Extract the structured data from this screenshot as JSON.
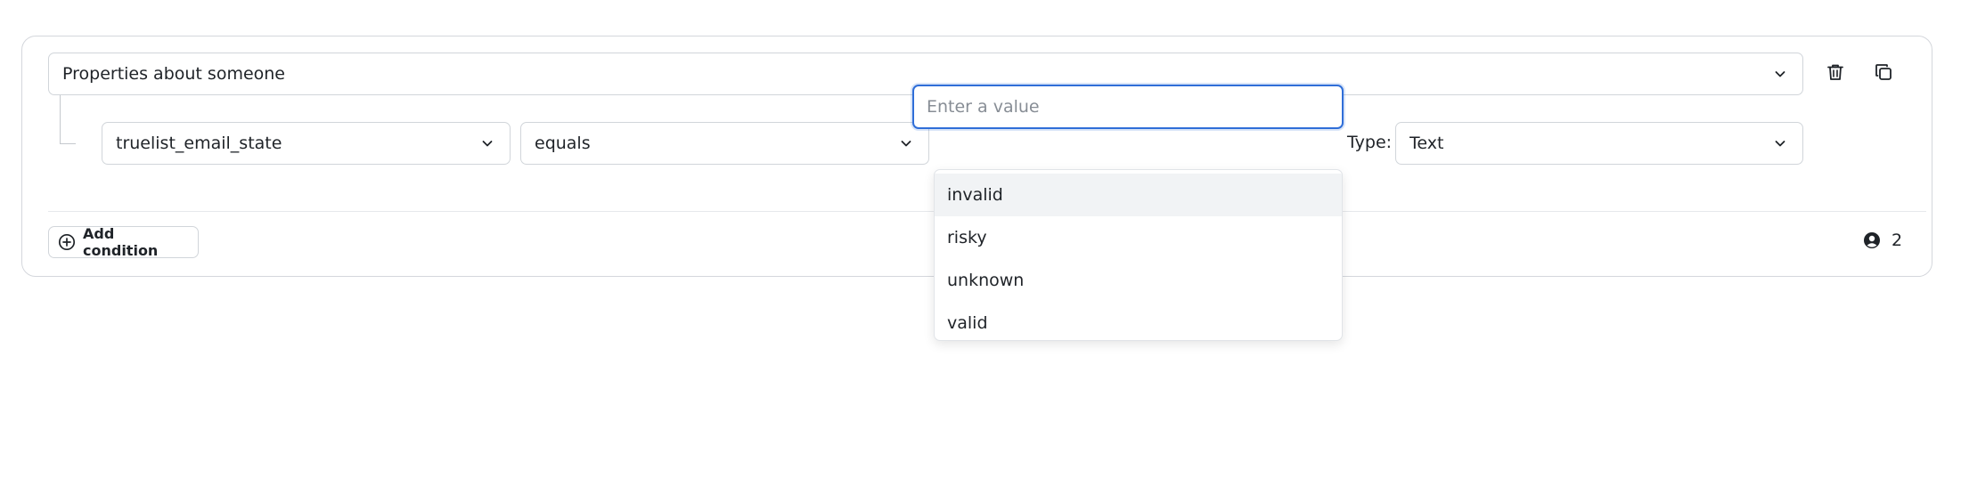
{
  "group_select": {
    "value": "Properties about someone"
  },
  "condition": {
    "property": "truelist_email_state",
    "operator": "equals",
    "value": "",
    "value_placeholder": "Enter a value",
    "type_label": "Type:",
    "type": "Text"
  },
  "value_options": [
    {
      "label": "invalid"
    },
    {
      "label": "risky"
    },
    {
      "label": "unknown"
    },
    {
      "label": "valid"
    }
  ],
  "add_condition_label": "Add condition",
  "people_count": "2",
  "icons": {
    "delete": "trash-icon",
    "duplicate": "copy-icon",
    "add": "plus-circle-icon",
    "people": "user-circle-icon",
    "dropdown": "chevron-down-icon"
  },
  "colors": {
    "focus_border": "#2f6ed8",
    "active_option_bg": "#f1f3f5",
    "border": "#d1d5da"
  }
}
